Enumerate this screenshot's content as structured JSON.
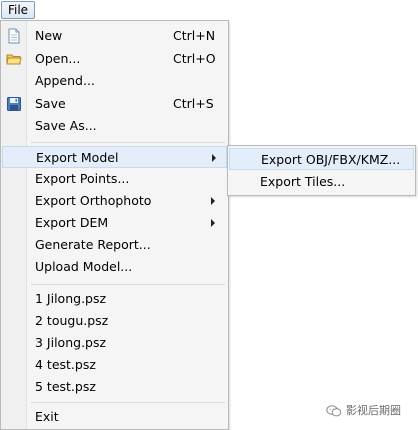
{
  "menubar": {
    "file_label": "File"
  },
  "file_menu": {
    "items": [
      {
        "label": "New",
        "shortcut": "Ctrl+N",
        "icon": "new-file-icon"
      },
      {
        "label": "Open...",
        "shortcut": "Ctrl+O",
        "icon": "open-folder-icon"
      },
      {
        "label": "Append..."
      },
      {
        "label": "Save",
        "shortcut": "Ctrl+S",
        "icon": "save-icon"
      },
      {
        "label": "Save As..."
      },
      {
        "label": "Export Model",
        "submenu": true,
        "highlighted": true
      },
      {
        "label": "Export Points..."
      },
      {
        "label": "Export Orthophoto",
        "submenu": true
      },
      {
        "label": "Export DEM",
        "submenu": true
      },
      {
        "label": "Generate Report..."
      },
      {
        "label": "Upload Model..."
      },
      {
        "label": "1 Jilong.psz"
      },
      {
        "label": "2 tougu.psz"
      },
      {
        "label": "3 Jilong.psz"
      },
      {
        "label": "4 test.psz"
      },
      {
        "label": "5 test.psz"
      },
      {
        "label": "Exit"
      }
    ]
  },
  "export_model_submenu": {
    "items": [
      {
        "label": "Export OBJ/FBX/KMZ...",
        "highlighted": true
      },
      {
        "label": "Export Tiles..."
      }
    ]
  },
  "watermark": {
    "text": "影视后期圈"
  },
  "colors": {
    "menu_bg": "#f5f5f5",
    "highlight_bg": "#e4eefa",
    "highlight_border": "#c8daf0",
    "border": "#b9b9b9"
  }
}
